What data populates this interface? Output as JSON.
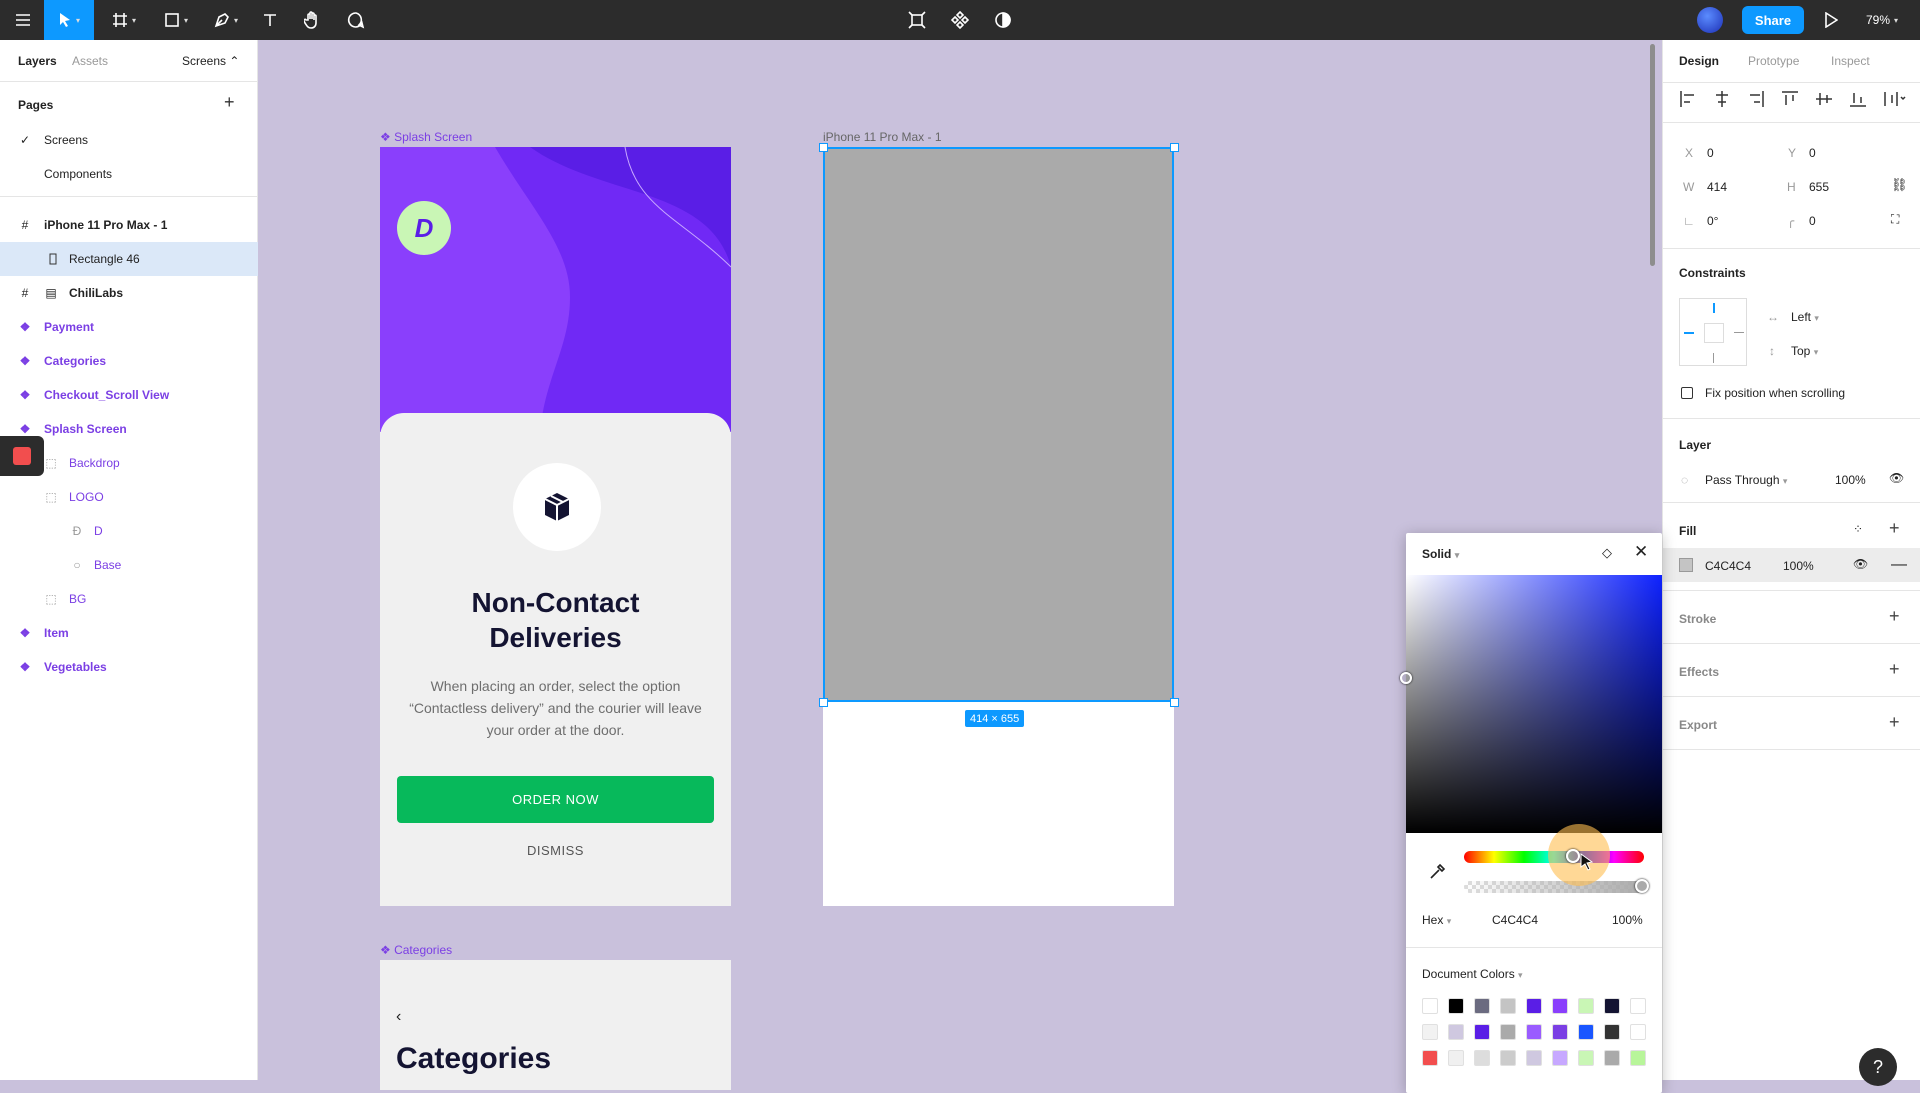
{
  "toolbar": {
    "zoom": "79%",
    "share_label": "Share"
  },
  "left_panel": {
    "tabs": {
      "layers": "Layers",
      "assets": "Assets",
      "page_switch": "Screens ⌃"
    },
    "pages_title": "Pages",
    "pages": [
      "Screens",
      "Components"
    ],
    "layers": [
      "iPhone 11 Pro Max - 1",
      "Rectangle 46",
      "ChiliLabs",
      "Payment",
      "Categories",
      "Checkout_Scroll View",
      "Splash Screen",
      "Backdrop",
      "LOGO",
      "D",
      "Base",
      "BG",
      "Item",
      "Vegetables"
    ]
  },
  "canvas": {
    "splash_label": "Splash Screen",
    "iphone_label": "iPhone 11 Pro Max - 1",
    "categories_label": "Categories",
    "logo_letter": "D",
    "title_line1": "Non-Contact",
    "title_line2": "Deliveries",
    "description": "When placing an order, select the option “Contactless delivery” and the courier will leave your order at the door.",
    "order_button": "ORDER NOW",
    "dismiss": "DISMISS",
    "size_badge": "414 × 655",
    "categories_back": "‹",
    "categories_title": "Categories"
  },
  "right_panel": {
    "tabs": {
      "design": "Design",
      "prototype": "Prototype",
      "inspect": "Inspect"
    },
    "x_label": "X",
    "x": "0",
    "y_label": "Y",
    "y": "0",
    "w_label": "W",
    "w": "414",
    "h_label": "H",
    "h": "655",
    "rotation": "0°",
    "radius": "0",
    "constraints_title": "Constraints",
    "constraint_h": "Left",
    "constraint_v": "Top",
    "fix_position": "Fix position when scrolling",
    "layer_title": "Layer",
    "blend": "Pass Through",
    "layer_opacity": "100%",
    "fill_title": "Fill",
    "fill_hex": "C4C4C4",
    "fill_opacity": "100%",
    "stroke_title": "Stroke",
    "effects_title": "Effects",
    "export_title": "Export"
  },
  "picker": {
    "mode": "Solid",
    "format": "Hex",
    "hex": "C4C4C4",
    "opacity": "100%",
    "doc_colors_title": "Document Colors",
    "swatches": [
      [
        "#ffffff",
        "#000000",
        "#6b6b80",
        "#c4c4c4",
        "#5a1ee6",
        "#8a3ffc",
        "#c9f6b5",
        "#141432",
        "#ffffff"
      ],
      [
        "#f2f2f2",
        "#cfc8e0",
        "#5a1ee6",
        "#aaaaaa",
        "#9a5cff",
        "#7b3fe4",
        "#1a56ff",
        "#333333",
        "#ffffff"
      ],
      [
        "#f24e4e",
        "#f0f0f0",
        "#dddddd",
        "#cccccc",
        "#cfc8e0",
        "#c7a8ff",
        "#c9f6b5",
        "#aaaaaa",
        "#b8f59a"
      ]
    ]
  },
  "colors": {
    "accent": "#0d99ff",
    "purple": "#7b3fe4",
    "green_button": "#07b95b",
    "canvas_bg": "#c9c1dc"
  }
}
